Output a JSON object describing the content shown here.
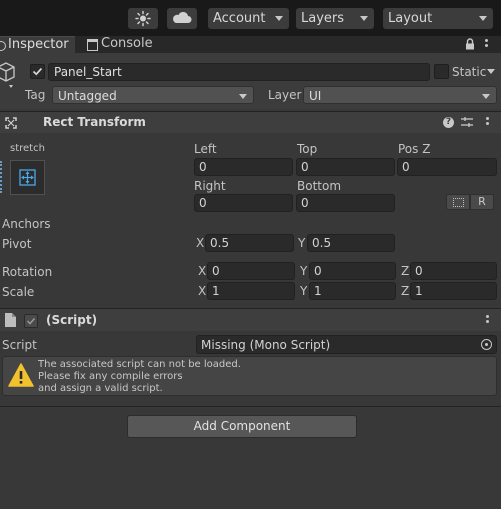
{
  "toolbar": {
    "account": "Account",
    "layers": "Layers",
    "layout": "Layout"
  },
  "tabs": {
    "inspector": "Inspector",
    "console": "Console"
  },
  "object": {
    "name": "Panel_Start",
    "static_label": "Static",
    "tag_label": "Tag",
    "tag_value": "Untagged",
    "layer_label": "Layer",
    "layer_value": "UI"
  },
  "rect_transform": {
    "title": "Rect Transform",
    "anchor_preset": "stretch",
    "left_label": "Left",
    "left": "0",
    "top_label": "Top",
    "top": "0",
    "posz_label": "Pos Z",
    "posz": "0",
    "right_label": "Right",
    "right": "0",
    "bottom_label": "Bottom",
    "bottom": "0",
    "r_button": "R",
    "anchors_label": "Anchors",
    "pivot_label": "Pivot",
    "pivot_x": "0.5",
    "pivot_y": "0.5",
    "rotation_label": "Rotation",
    "rotation_x": "0",
    "rotation_y": "0",
    "rotation_z": "0",
    "scale_label": "Scale",
    "scale_x": "1",
    "scale_y": "1",
    "scale_z": "1",
    "axis_x": "X",
    "axis_y": "Y",
    "axis_z": "Z"
  },
  "script_component": {
    "title": "(Script)",
    "script_label": "Script",
    "script_value": "Missing (Mono Script)",
    "warning_line1": "The associated script can not be loaded.",
    "warning_line2": "Please fix any compile errors",
    "warning_line3": "and assign a valid script."
  },
  "add_component": "Add Component",
  "colors": {
    "background": "#383838",
    "toolbar": "#191919",
    "field": "#2a2a2a",
    "warning": "#f2c12e",
    "anchor_blue": "#4aa9e8"
  }
}
